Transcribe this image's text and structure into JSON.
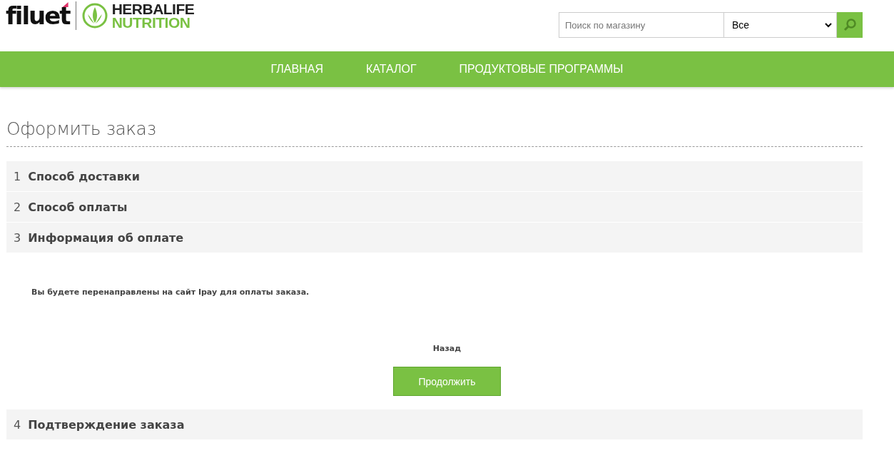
{
  "logo": {
    "brand": "filuet",
    "partner_top": "HERBALIFE",
    "partner_bottom": "NUTRITION"
  },
  "search": {
    "placeholder": "Поиск по магазину",
    "scope": "Все"
  },
  "nav": [
    {
      "label": "ГЛАВНАЯ"
    },
    {
      "label": "КАТАЛОГ"
    },
    {
      "label": "ПРОДУКТОВЫЕ ПРОГРАММЫ"
    }
  ],
  "page_title": "Оформить заказ",
  "steps": [
    {
      "number": "1",
      "title": "Способ доставки"
    },
    {
      "number": "2",
      "title": "Способ оплаты"
    },
    {
      "number": "3",
      "title": "Информация об оплате",
      "body": {
        "message": "Вы будете перенаправлены на сайт Ipay для оплаты заказа.",
        "back_link": "Назад",
        "continue_button": "Продолжить"
      }
    },
    {
      "number": "4",
      "title": "Подтверждение заказа"
    }
  ]
}
